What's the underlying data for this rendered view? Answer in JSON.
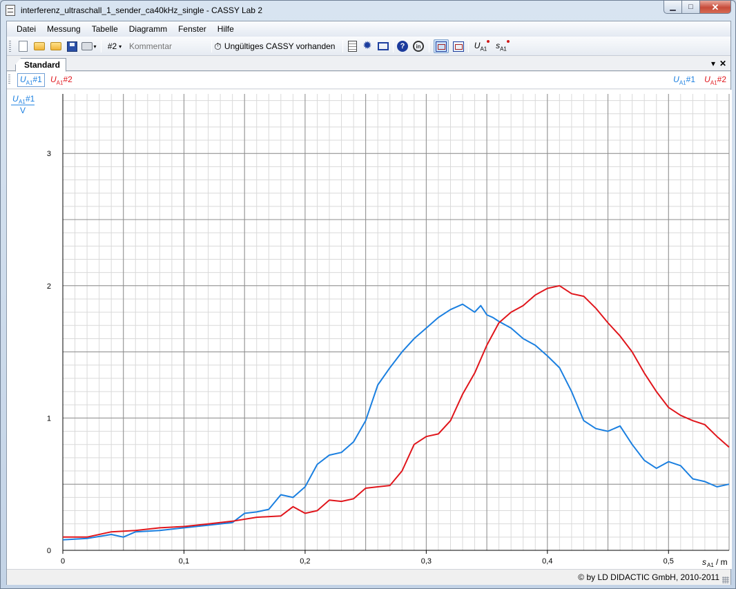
{
  "window": {
    "title": "interferenz_ultraschall_1_sender_ca40kHz_single - CASSY Lab 2",
    "min_glyph": "▁",
    "max_glyph": "□",
    "close_glyph": "✕"
  },
  "menu": [
    "Datei",
    "Messung",
    "Tabelle",
    "Diagramm",
    "Fenster",
    "Hilfe"
  ],
  "toolbar": {
    "measurement_series": "#2",
    "comment_placeholder": "Kommentar",
    "cassy_status": "Ungültiges CASSY vorhanden",
    "var_u": "U",
    "var_u_sub": "A1",
    "var_s": "s",
    "var_s_sub": "A1"
  },
  "tabs": {
    "active": "Standard",
    "pin": "▾",
    "close": "✕"
  },
  "legend": {
    "series1": {
      "var": "U",
      "sub": "A1",
      "suffix": "#1"
    },
    "series2": {
      "var": "U",
      "sub": "A1",
      "suffix": "#2"
    }
  },
  "status": {
    "copyright": "©  by LD DIDACTIC GmbH, 2010-2011"
  },
  "chart_data": {
    "type": "line",
    "xlabel": "sA1 / m",
    "ylabel": "UA1#1 / V",
    "xlim": [
      0,
      0.55
    ],
    "ylim": [
      0,
      3.45
    ],
    "xticks": [
      "0",
      "0,1",
      "0,2",
      "0,3",
      "0,4",
      "0,5"
    ],
    "yticks": [
      "0",
      "1",
      "2",
      "3"
    ],
    "grid": true,
    "colors": {
      "series1": "#1a7fe0",
      "series2": "#e0151b"
    },
    "series": [
      {
        "name": "UA1#1",
        "x": [
          0,
          0.02,
          0.04,
          0.05,
          0.06,
          0.08,
          0.1,
          0.12,
          0.14,
          0.15,
          0.16,
          0.17,
          0.18,
          0.19,
          0.2,
          0.21,
          0.22,
          0.23,
          0.24,
          0.25,
          0.26,
          0.27,
          0.28,
          0.29,
          0.3,
          0.31,
          0.32,
          0.33,
          0.34,
          0.345,
          0.35,
          0.355,
          0.36,
          0.37,
          0.38,
          0.39,
          0.4,
          0.41,
          0.42,
          0.43,
          0.44,
          0.45,
          0.46,
          0.47,
          0.48,
          0.49,
          0.5,
          0.51,
          0.52,
          0.53,
          0.54,
          0.55
        ],
        "y": [
          0.08,
          0.09,
          0.12,
          0.1,
          0.14,
          0.15,
          0.17,
          0.19,
          0.21,
          0.28,
          0.29,
          0.31,
          0.42,
          0.4,
          0.48,
          0.65,
          0.72,
          0.74,
          0.82,
          0.98,
          1.25,
          1.38,
          1.5,
          1.6,
          1.68,
          1.76,
          1.82,
          1.86,
          1.8,
          1.85,
          1.78,
          1.76,
          1.73,
          1.68,
          1.6,
          1.55,
          1.47,
          1.38,
          1.2,
          0.98,
          0.92,
          0.9,
          0.94,
          0.8,
          0.68,
          0.62,
          0.67,
          0.64,
          0.54,
          0.52,
          0.48,
          0.5
        ]
      },
      {
        "name": "UA1#2",
        "x": [
          0,
          0.02,
          0.04,
          0.06,
          0.08,
          0.1,
          0.12,
          0.14,
          0.16,
          0.18,
          0.19,
          0.2,
          0.21,
          0.22,
          0.23,
          0.24,
          0.25,
          0.26,
          0.27,
          0.28,
          0.29,
          0.3,
          0.31,
          0.32,
          0.33,
          0.34,
          0.35,
          0.36,
          0.37,
          0.38,
          0.39,
          0.4,
          0.41,
          0.42,
          0.43,
          0.44,
          0.45,
          0.46,
          0.47,
          0.48,
          0.49,
          0.5,
          0.51,
          0.52,
          0.53,
          0.54,
          0.55
        ],
        "y": [
          0.1,
          0.1,
          0.14,
          0.15,
          0.17,
          0.18,
          0.2,
          0.22,
          0.25,
          0.26,
          0.33,
          0.28,
          0.3,
          0.38,
          0.37,
          0.39,
          0.47,
          0.48,
          0.49,
          0.6,
          0.8,
          0.86,
          0.88,
          0.98,
          1.18,
          1.34,
          1.55,
          1.72,
          1.8,
          1.85,
          1.93,
          1.98,
          2.0,
          1.94,
          1.92,
          1.83,
          1.72,
          1.62,
          1.5,
          1.34,
          1.2,
          1.08,
          1.02,
          0.98,
          0.95,
          0.86,
          0.78
        ]
      }
    ]
  }
}
